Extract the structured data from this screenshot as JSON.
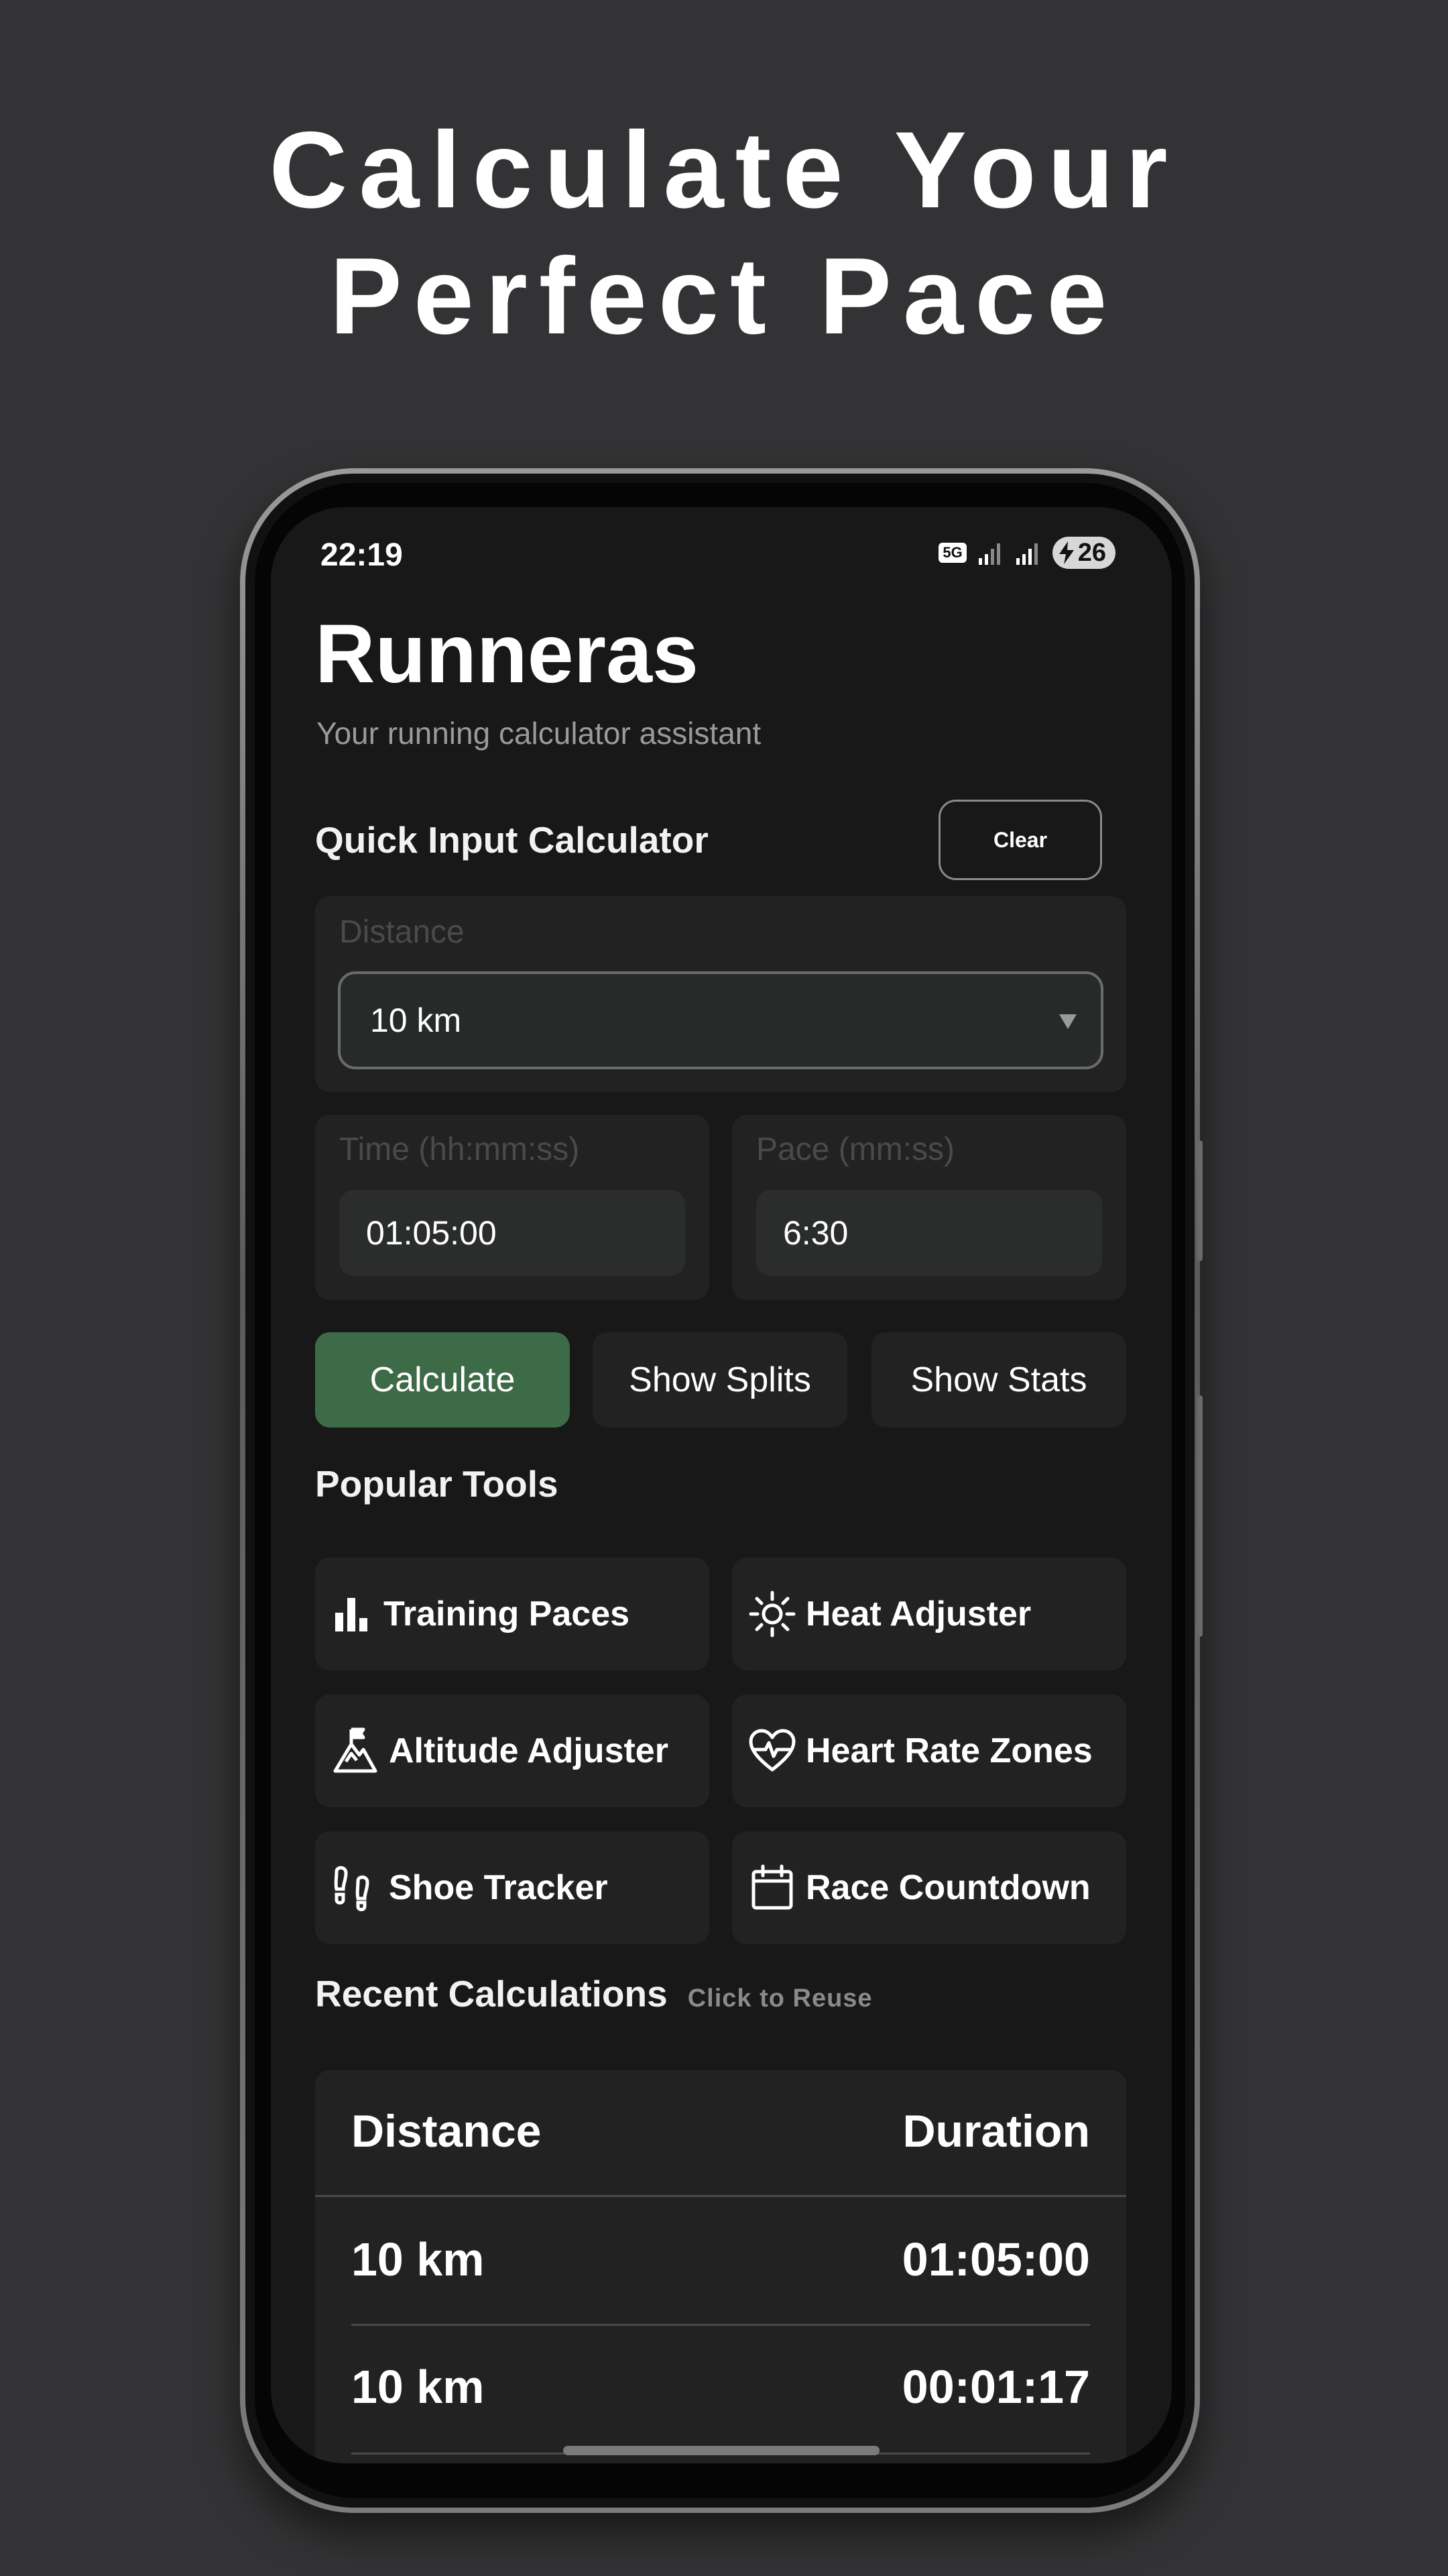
{
  "headline": {
    "line1": "Calculate Your",
    "line2": "Perfect Pace"
  },
  "status_bar": {
    "time": "22:19",
    "network": "5G",
    "battery": "26"
  },
  "app": {
    "title": "Runneras",
    "subtitle": "Your running calculator assistant"
  },
  "quick_input": {
    "title": "Quick Input Calculator",
    "clear_label": "Clear",
    "distance_label": "Distance",
    "distance_value": "10 km",
    "time_label": "Time (hh:mm:ss)",
    "time_value": "01:05:00",
    "pace_label": "Pace (mm:ss)",
    "pace_value": "6:30"
  },
  "actions": {
    "calculate": "Calculate",
    "show_splits": "Show Splits",
    "show_stats": "Show Stats"
  },
  "popular_tools": {
    "title": "Popular Tools",
    "items": [
      {
        "label": "Training Paces",
        "icon": "bar-chart-icon"
      },
      {
        "label": "Heat Adjuster",
        "icon": "sun-icon"
      },
      {
        "label": "Altitude Adjuster",
        "icon": "mountain-flag-icon"
      },
      {
        "label": "Heart Rate Zones",
        "icon": "heart-pulse-icon"
      },
      {
        "label": "Shoe Tracker",
        "icon": "footprints-icon"
      },
      {
        "label": "Race Countdown",
        "icon": "calendar-icon"
      }
    ]
  },
  "recent": {
    "title": "Recent Calculations",
    "hint": "Click to Reuse",
    "headers": {
      "distance": "Distance",
      "duration": "Duration"
    },
    "rows": [
      {
        "distance": "10 km",
        "duration": "01:05:00"
      },
      {
        "distance": "10 km",
        "duration": "00:01:17"
      }
    ]
  },
  "colors": {
    "accent": "#3d6b47",
    "background": "#333335",
    "screen": "#181818",
    "card": "#222222"
  }
}
